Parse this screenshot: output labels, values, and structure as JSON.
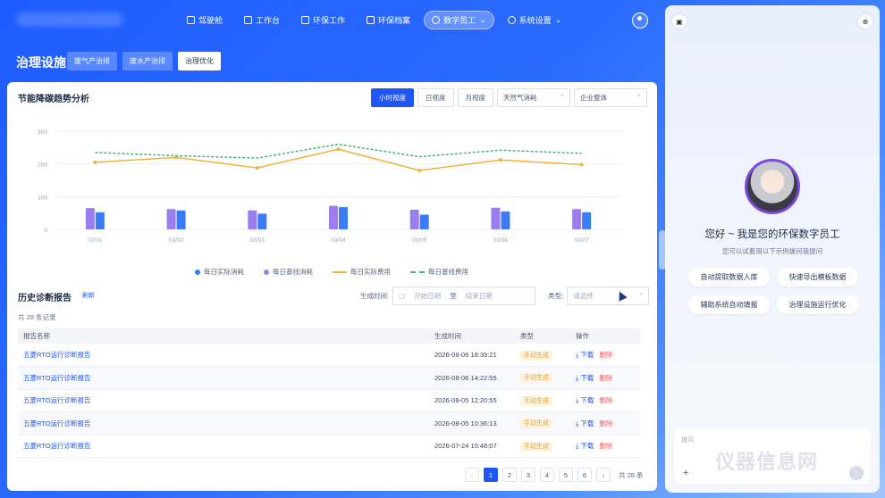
{
  "nav": {
    "items": [
      {
        "label": "驾驶舱",
        "icon": "cockpit-icon",
        "active": false
      },
      {
        "label": "工作台",
        "icon": "workbench-icon",
        "active": false
      },
      {
        "label": "环保工作",
        "icon": "eco-work-icon",
        "active": false
      },
      {
        "label": "环保档案",
        "icon": "archive-icon",
        "active": false
      },
      {
        "label": "数字员工",
        "icon": "digital-staff-icon",
        "active": true
      },
      {
        "label": "系统设置",
        "icon": "gear-icon",
        "active": false
      }
    ]
  },
  "page": {
    "title": "治理设施",
    "subtabs": [
      "废气产治排",
      "废水产治排",
      "治理优化"
    ],
    "active_subtab": 2
  },
  "chart_section": {
    "title": "节能降碳趋势分析",
    "segments": [
      "小时视度",
      "日视度",
      "月视度"
    ],
    "active_segment": 0,
    "select1": "天然气消耗",
    "select2": "企业整体"
  },
  "chart_data": {
    "type": "bar",
    "categories": [
      "03/01",
      "03/02",
      "03/03",
      "03/04",
      "03/05",
      "03/06",
      "03/07"
    ],
    "ylim": [
      0,
      300
    ],
    "yticks": [
      "0",
      "100",
      "200",
      "300"
    ],
    "series": [
      {
        "name": "每日实际消耗",
        "type": "bar",
        "color": "#3b7bf5",
        "values": [
          52,
          58,
          48,
          68,
          45,
          55,
          52
        ]
      },
      {
        "name": "每日基线消耗",
        "type": "bar",
        "color": "#9b7df0",
        "values": [
          65,
          62,
          58,
          72,
          60,
          66,
          62
        ]
      },
      {
        "name": "每日实际费用",
        "type": "line",
        "color": "#f0b23a",
        "values": [
          205,
          220,
          188,
          245,
          180,
          212,
          198
        ]
      },
      {
        "name": "每日基线费用",
        "type": "dashed",
        "color": "#45b27a",
        "values": [
          235,
          225,
          218,
          260,
          222,
          242,
          232
        ]
      }
    ]
  },
  "history": {
    "title": "历史诊断报告",
    "refresh": "刷新",
    "date_label": "生成时间:",
    "start_ph": "开始日期",
    "to": "至",
    "end_ph": "结束日期",
    "type_label": "类型:",
    "type_ph": "请选择",
    "count": "共 28 条记录",
    "columns": [
      "报告名称",
      "生成时间",
      "类型",
      "操作"
    ],
    "rows": [
      {
        "name": "五菱RTO运行诊断报告",
        "time": "2026-08-06 18:39:21",
        "type": "手动生成"
      },
      {
        "name": "五菱RTO运行诊断报告",
        "time": "2026-08-06 14:22:55",
        "type": "手动生成"
      },
      {
        "name": "五菱RTO运行诊断报告",
        "time": "2026-08-05 12:20:55",
        "type": "手动生成"
      },
      {
        "name": "五菱RTO运行诊断报告",
        "time": "2026-08-05 10:36:13",
        "type": "手动生成"
      },
      {
        "name": "五菱RTO运行诊断报告",
        "time": "2026-07-24 10:48:07",
        "type": "手动生成"
      }
    ],
    "download": "下载",
    "delete": "删除",
    "pages": [
      "1",
      "2",
      "3",
      "4",
      "5",
      "6"
    ],
    "active_page": 0,
    "prev": "‹",
    "next": "›",
    "total": "共 28 条"
  },
  "assistant": {
    "greeting": "您好 ~ 我是您的环保数字员工",
    "hint": "您可以试着用以下示例提问我提问",
    "chips": [
      "自动提取数据入库",
      "快速导出模板数据",
      "辅助系统自动填报",
      "治理设施运行优化"
    ],
    "input_placeholder": "提问",
    "watermark": "仪器信息网"
  }
}
